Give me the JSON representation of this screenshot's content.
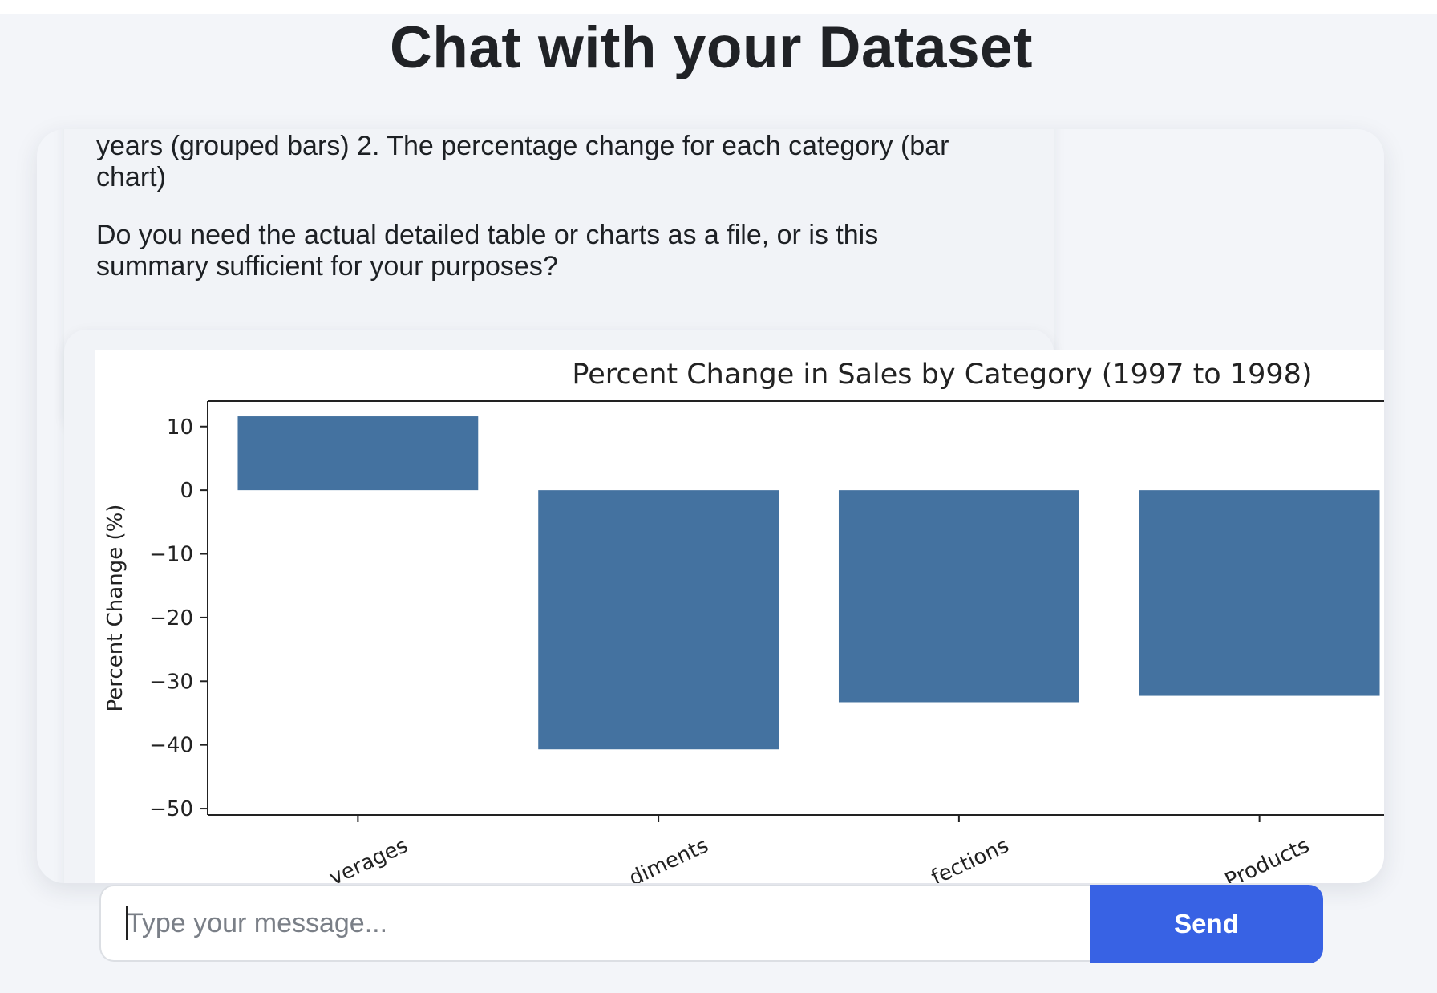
{
  "page": {
    "title": "Chat with your Dataset"
  },
  "messages": [
    {
      "role": "assistant",
      "paragraphs": [
        "chart)",
        "Do you need the actual detailed table or charts as a file, or is this summary sufficient for your purposes?"
      ],
      "clipped_line": "years (grouped bars) 2. The percentage change for each category (bar"
    }
  ],
  "chart_data": {
    "type": "bar",
    "title": "Percent Change in Sales by Category (1997 to 1998)",
    "ylabel": "Percent Change (%)",
    "xlabel": "",
    "categories": [
      "Beverages",
      "Condiments",
      "Confections",
      "Dairy Products"
    ],
    "categories_visible_fragments": [
      "verages",
      "diments",
      "fections",
      "Products"
    ],
    "values": [
      11.6,
      -40.7,
      -33.3,
      -32.3
    ],
    "ylim": [
      -51,
      14
    ],
    "yticks": [
      10,
      0,
      -10,
      -20,
      -30,
      -40,
      -50
    ],
    "ytick_labels": [
      "10",
      "0",
      "−10",
      "−20",
      "−30",
      "−40",
      "−50"
    ],
    "bar_color": "#4472a0",
    "grid": false
  },
  "composer": {
    "placeholder": "Type your message...",
    "value": "",
    "send_label": "Send",
    "send_color": "#3862e4"
  }
}
